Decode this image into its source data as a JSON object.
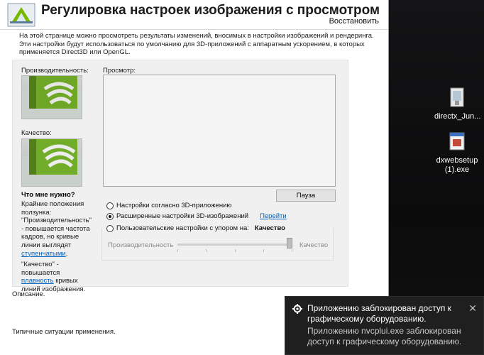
{
  "window": {
    "title": "Регулировка настроек изображения с просмотром",
    "restore_link": "Восстановить",
    "intro": "На этой странице можно просмотреть результаты изменений, вносимых в настройки изображений и рендеринга. Эти настройки будут использоваться по умолчанию для 3D-приложений с аппаратным ускорением, в которых применяется Direct3D или OpenGL."
  },
  "left": {
    "performance_label": "Производительность:",
    "quality_label": "Качество:",
    "help_title": "Что мне нужно?",
    "help_text_1": "Крайние положения ползунка: \"Производительность\" - повышается частота кадров, но кривые линии выглядят ",
    "help_link_1": "ступенчатыми",
    "help_text_1_end": ".",
    "help_text_2": "\"Качество\" - повышается ",
    "help_link_2": "плавность",
    "help_text_2_end": " кривых линий изображения."
  },
  "preview": {
    "label": "Просмотр:",
    "pause_button": "Пауза"
  },
  "options": {
    "option1": "Настройки согласно 3D-приложению",
    "option2": "Расширенные настройки 3D-изображений",
    "option2_link": "Перейти",
    "option3": "Пользовательские настройки с упором на:",
    "option3_value": "Качество",
    "selected": 2
  },
  "slider": {
    "left_label": "Производительность",
    "right_label": "Качество",
    "position_fraction": 1.0
  },
  "bottom": {
    "description_label": "Описание.",
    "usage_label": "Типичные ситуации применения."
  },
  "desktop": {
    "icon1_label": "directx_Jun...",
    "icon2_label": "dxwebsetup (1).exe"
  },
  "toast": {
    "title": "Приложению заблокирован доступ к графическому оборудованию.",
    "body": "Приложению nvcplui.exe заблокирован доступ к графическому оборудованию.",
    "close": "✕"
  }
}
